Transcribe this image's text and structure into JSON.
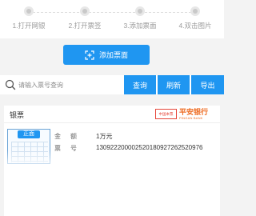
{
  "steps": [
    {
      "label": "1.打开网银"
    },
    {
      "label": "2.打开票签"
    },
    {
      "label": "3.添加票面"
    },
    {
      "label": "4.双击图片"
    }
  ],
  "add_button": {
    "label": "添加票面",
    "icon": "add-image-icon"
  },
  "search": {
    "placeholder": "请输入票号查询",
    "icon": "search-icon"
  },
  "actions": {
    "query": "查询",
    "refresh": "刷新",
    "export": "导出"
  },
  "card": {
    "title": "银票",
    "bank_tag": "中国本票",
    "bank_name_cn": "平安银行",
    "bank_name_en": "PINGAN BANK",
    "thumb_badge": "正面",
    "amount": {
      "k1": "金",
      "k2": "额",
      "value": "1万元"
    },
    "number": {
      "k1": "票",
      "k2": "号",
      "value": "130922200002520180927262520976"
    }
  },
  "colors": {
    "primary": "#1f96f1",
    "bank": "#ee6d24",
    "tag": "#e6463a"
  }
}
